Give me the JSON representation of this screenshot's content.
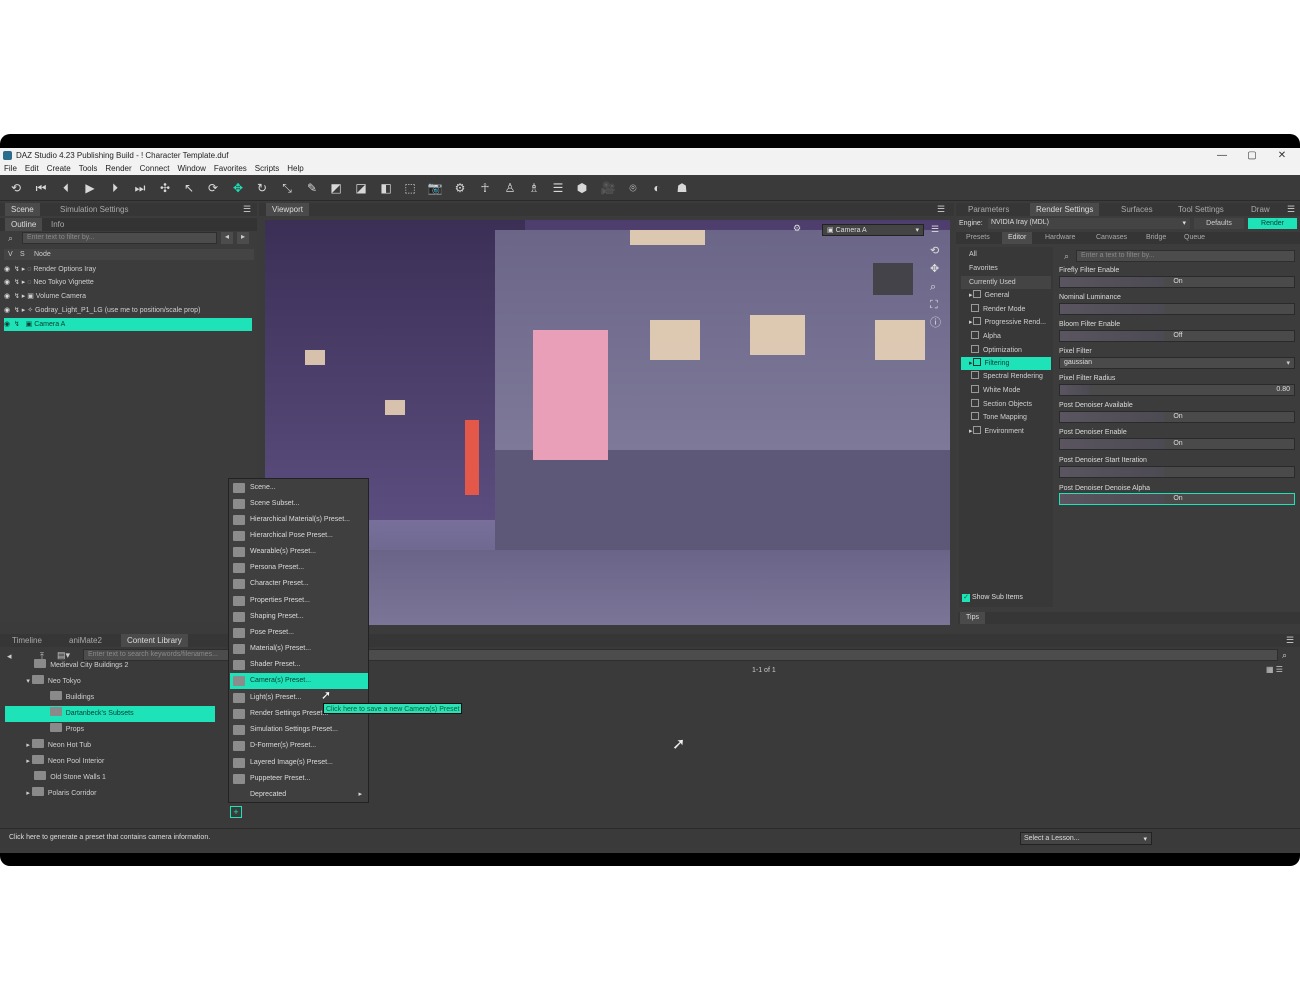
{
  "window": {
    "title": "DAZ Studio 4.23 Publishing Build - ! Character Template.duf",
    "minimize": "—",
    "maximize": "▢",
    "close": "✕"
  },
  "menubar": [
    "File",
    "Edit",
    "Create",
    "Tools",
    "Render",
    "Connect",
    "Window",
    "Favorites",
    "Scripts",
    "Help"
  ],
  "left_panel": {
    "tabs": [
      "Scene",
      "Simulation Settings"
    ],
    "subtabs": [
      "Outline",
      "Info"
    ],
    "filter_placeholder": "Enter text to filter by...",
    "col_v": "V",
    "col_s": "S",
    "col_node": "Node",
    "nodes": [
      "Render Options Iray",
      "Neo Tokyo Vignette",
      "Volume Camera",
      "Godray_Light_P1_LG (use me to position/scale prop)",
      "Camera A"
    ]
  },
  "viewport": {
    "tab": "Viewport",
    "camera": "Camera A"
  },
  "right_panel": {
    "tabs": [
      "Parameters",
      "Render Settings",
      "Surfaces",
      "Tool Settings",
      "Draw"
    ],
    "engine_label": "Engine:",
    "engine_value": "NVIDIA Iray (MDL)",
    "defaults": "Defaults",
    "render": "Render",
    "subtabs": [
      "Presets",
      "Editor",
      "Hardware",
      "Canvases",
      "Bridge",
      "Queue"
    ],
    "categories": [
      "All",
      "Favorites",
      "Currently Used",
      "General",
      "Render Mode",
      "Progressive Rend...",
      "Alpha",
      "Optimization",
      "Filtering",
      "Spectral Rendering",
      "White Mode",
      "Section Objects",
      "Tone Mapping",
      "Environment"
    ],
    "show_sub_items": "Show Sub Items",
    "filter_placeholder": "Enter a text to filter by...",
    "props": [
      {
        "label": "Firefly Filter Enable",
        "value": "On"
      },
      {
        "label": "Nominal Luminance",
        "value": ""
      },
      {
        "label": "Bloom Filter Enable",
        "value": "Off"
      },
      {
        "label": "Pixel Filter",
        "value": "gaussian"
      },
      {
        "label": "Pixel Filter Radius",
        "value": "0.80"
      },
      {
        "label": "Post Denoiser Available",
        "value": "On"
      },
      {
        "label": "Post Denoiser Enable",
        "value": "On"
      },
      {
        "label": "Post Denoiser Start Iteration",
        "value": ""
      },
      {
        "label": "Post Denoiser Denoise Alpha",
        "value": "On"
      }
    ],
    "tips": "Tips"
  },
  "bottom_panel": {
    "tabs": [
      "Timeline",
      "aniMate2",
      "Content Library"
    ],
    "search_placeholder": "Enter text to search keywords/filenames...",
    "count": "1-1 of 1",
    "library": [
      "Medieval City Buildings 2",
      "Neo Tokyo",
      "Buildings",
      "Dartanbeck's Subsets",
      "Props",
      "Neon Hot Tub",
      "Neon Pool Interior",
      "Old Stone Walls 1",
      "Polaris Corridor"
    ]
  },
  "context_menu": [
    "Scene...",
    "Scene Subset...",
    "Hierarchical Material(s) Preset...",
    "Hierarchical Pose Preset...",
    "Wearable(s) Preset...",
    "Persona Preset...",
    "Character Preset...",
    "Properties Preset...",
    "Shaping Preset...",
    "Pose Preset...",
    "Material(s) Preset...",
    "Shader Preset...",
    "Camera(s) Preset...",
    "Light(s) Preset...",
    "Render Settings Preset...",
    "Simulation Settings Preset...",
    "D-Former(s) Preset...",
    "Layered Image(s) Preset...",
    "Puppeteer Preset...",
    "Deprecated"
  ],
  "tooltip": "Click here to save a new Camera(s) Preset",
  "status": {
    "text": "Click here to generate a preset that contains camera information.",
    "lesson": "Select a Lesson..."
  },
  "colors": {
    "accent": "#1ee3b8",
    "bg": "#3b3b3b"
  }
}
